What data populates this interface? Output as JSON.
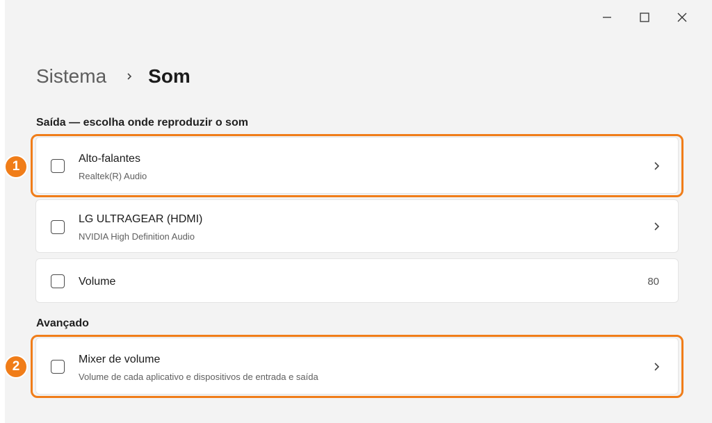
{
  "window": {
    "controls": [
      "minimize-icon",
      "maximize-icon",
      "close-icon"
    ]
  },
  "breadcrumb": {
    "parent": "Sistema",
    "current": "Som"
  },
  "output": {
    "section_title": "Saída — escolha onde reproduzir o som",
    "devices": [
      {
        "title": "Alto-falantes",
        "subtitle": "Realtek(R) Audio"
      },
      {
        "title": "LG ULTRAGEAR (HDMI)",
        "subtitle": "NVIDIA High Definition Audio"
      }
    ],
    "volume": {
      "label": "Volume",
      "value": "80"
    }
  },
  "advanced": {
    "section_title": "Avançado",
    "mixer": {
      "title": "Mixer de volume",
      "subtitle": "Volume de cada aplicativo e dispositivos de entrada e saída"
    }
  },
  "annotations": [
    "1",
    "2"
  ],
  "colors": {
    "accent": "#f07d19",
    "background": "#f3f3f3",
    "card": "#ffffff"
  }
}
